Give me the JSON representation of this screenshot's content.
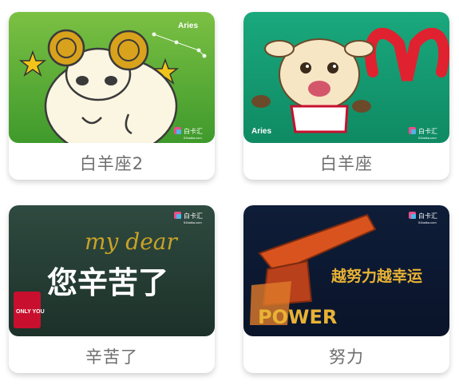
{
  "cards": [
    {
      "caption": "白羊座2",
      "art_text": "Aries",
      "logo_text": "白卡汇",
      "logo_url": "51baika.com",
      "colors": {
        "bg_top": "#7bc043",
        "bg_bottom": "#3f9a2c",
        "sheep": "#fbf6e2",
        "horn": "#d9a21c",
        "star": "#f2c41a"
      }
    },
    {
      "caption": "白羊座",
      "art_text": "Aries",
      "logo_text": "白卡汇",
      "logo_url": "51baika.com",
      "colors": {
        "bg_top": "#1aa87d",
        "bg_bottom": "#0f8a63",
        "symbol": "#e0212f",
        "sheep": "#f6e6c4"
      }
    },
    {
      "caption": "辛苦了",
      "art_text": "您辛苦了",
      "art_script": "my dear",
      "art_side": "ONLY YOU",
      "logo_text": "白卡汇",
      "logo_url": "51baika.com",
      "colors": {
        "bg_top": "#2f4a40",
        "bg_bottom": "#1c3129",
        "gold": "#c9a227",
        "side": "#c8102e"
      }
    },
    {
      "caption": "努力",
      "art_text": "越努力越幸运",
      "art_word": "POWER",
      "logo_text": "白卡汇",
      "logo_url": "51baika.com",
      "colors": {
        "bg_top": "#0e1d38",
        "bg_bottom": "#0a142a",
        "fire": "#d9531e",
        "gold": "#e8b235"
      }
    }
  ]
}
